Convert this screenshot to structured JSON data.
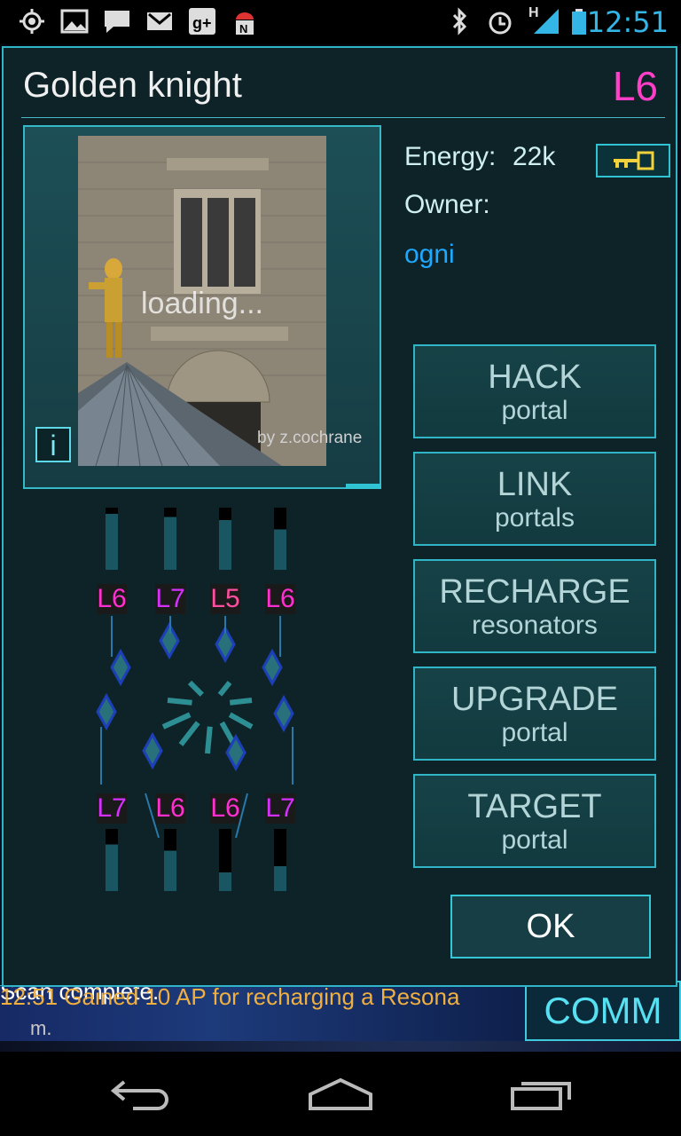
{
  "status_bar": {
    "time": "12:51",
    "network_label": "H"
  },
  "portal": {
    "name": "Golden knight",
    "level": "L6",
    "energy_label": "Energy:",
    "energy_value": "22k",
    "owner_label": "Owner:",
    "owner_name": "ogni",
    "image_loading_text": "loading...",
    "image_credit": "by z.cochrane",
    "info_label": "i"
  },
  "resonators": {
    "top": [
      {
        "level": "L6",
        "fill": 0.9
      },
      {
        "level": "L7",
        "fill": 0.85
      },
      {
        "level": "L5",
        "fill": 0.8
      },
      {
        "level": "L6",
        "fill": 0.65
      }
    ],
    "bottom": [
      {
        "level": "L7",
        "fill": 0.75
      },
      {
        "level": "L6",
        "fill": 0.65
      },
      {
        "level": "L6",
        "fill": 0.3
      },
      {
        "level": "L7",
        "fill": 0.4
      }
    ]
  },
  "actions": [
    {
      "title": "HACK",
      "subtitle": "portal"
    },
    {
      "title": "LINK",
      "subtitle": "portals"
    },
    {
      "title": "RECHARGE",
      "subtitle": "resonators"
    },
    {
      "title": "UPGRADE",
      "subtitle": "portal"
    },
    {
      "title": "TARGET",
      "subtitle": "portal"
    }
  ],
  "ok_label": "OK",
  "comm": {
    "label": "COMM",
    "line1": "Scan complete.",
    "line2": "12:51 Gained 10 AP for recharging a Resona",
    "line3": "m."
  },
  "colors": {
    "accent": "#2fb5c6",
    "level_magenta": "#ff3fc8",
    "owner_blue": "#1ea8ff"
  }
}
